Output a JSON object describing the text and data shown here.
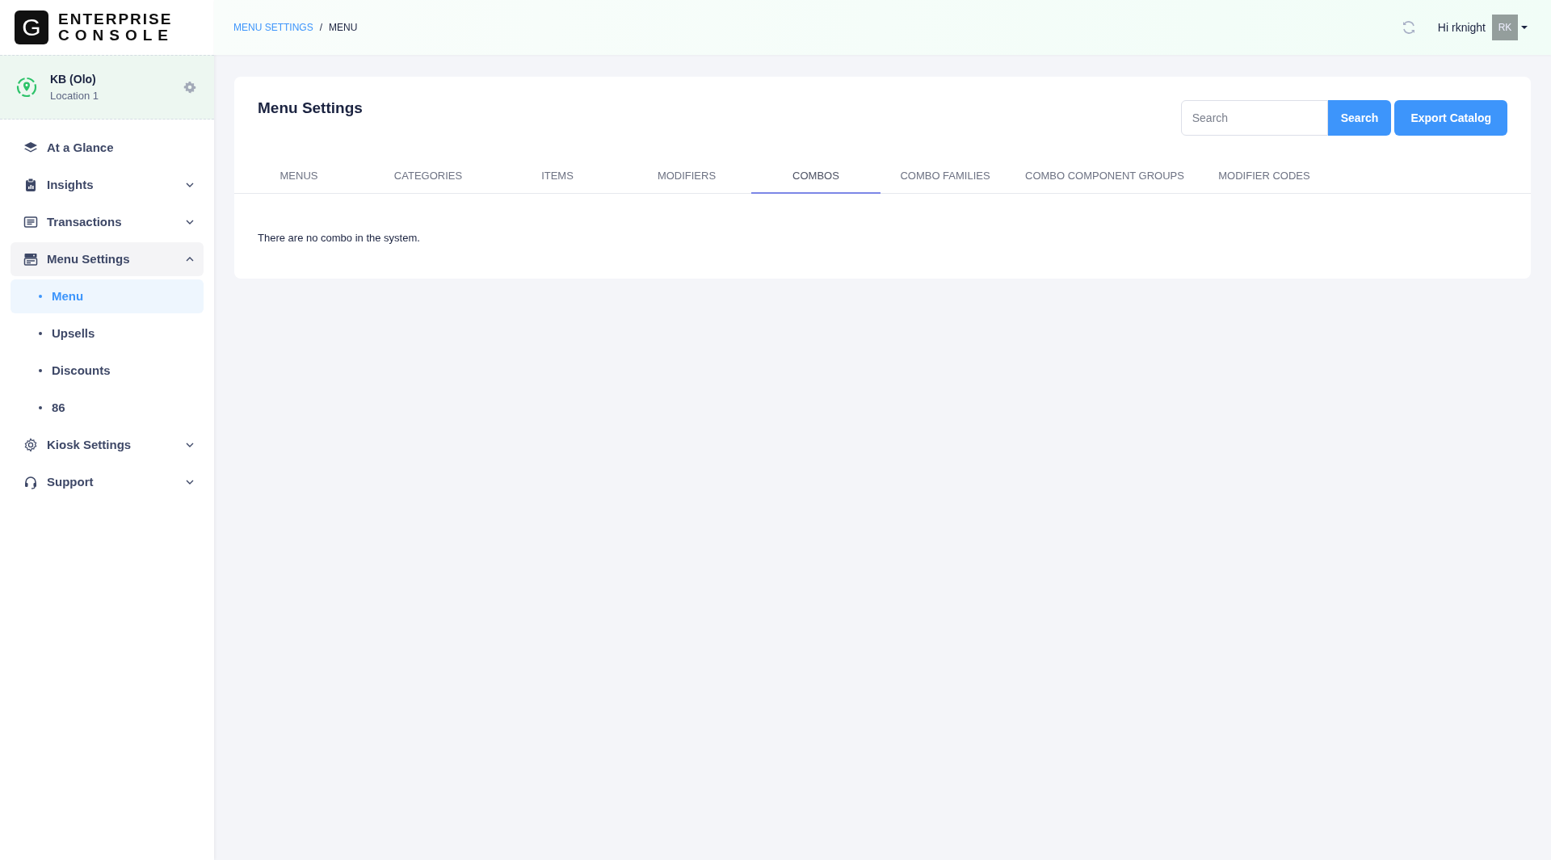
{
  "logo": {
    "letter": "G",
    "line1": "ENTERPRISE",
    "line2": "CONSOLE"
  },
  "location": {
    "name": "KB (Olo)",
    "subtitle": "Location 1"
  },
  "sidebar": {
    "items": [
      {
        "label": "At a Glance",
        "kind": "link"
      },
      {
        "label": "Insights",
        "kind": "group",
        "expanded": false
      },
      {
        "label": "Transactions",
        "kind": "group",
        "expanded": false
      },
      {
        "label": "Menu Settings",
        "kind": "group",
        "expanded": true,
        "children": [
          {
            "label": "Menu",
            "selected": true
          },
          {
            "label": "Upsells",
            "selected": false
          },
          {
            "label": "Discounts",
            "selected": false
          },
          {
            "label": "86",
            "selected": false
          }
        ]
      },
      {
        "label": "Kiosk Settings",
        "kind": "group",
        "expanded": false
      },
      {
        "label": "Support",
        "kind": "group",
        "expanded": false
      }
    ]
  },
  "breadcrumb": [
    {
      "label": "MENU SETTINGS",
      "kind": "link"
    },
    {
      "label": "/",
      "kind": "separator"
    },
    {
      "label": "MENU",
      "kind": "current"
    }
  ],
  "user": {
    "greeting": "Hi rknight",
    "initials": "RK"
  },
  "card": {
    "title": "Menu Settings",
    "search": {
      "placeholder": "Search"
    },
    "search_button": "Search",
    "export_button": "Export Catalog",
    "tabs": [
      {
        "label": "MENUS",
        "selected": false
      },
      {
        "label": "CATEGORIES",
        "selected": false
      },
      {
        "label": "ITEMS",
        "selected": false
      },
      {
        "label": "MODIFIERS",
        "selected": false
      },
      {
        "label": "COMBOS",
        "selected": true
      },
      {
        "label": "COMBO FAMILIES",
        "selected": false
      },
      {
        "label": "COMBO COMPONENT GROUPS",
        "selected": false
      },
      {
        "label": "MODIFIER CODES",
        "selected": false
      }
    ],
    "message": "There are no combo in the system."
  }
}
